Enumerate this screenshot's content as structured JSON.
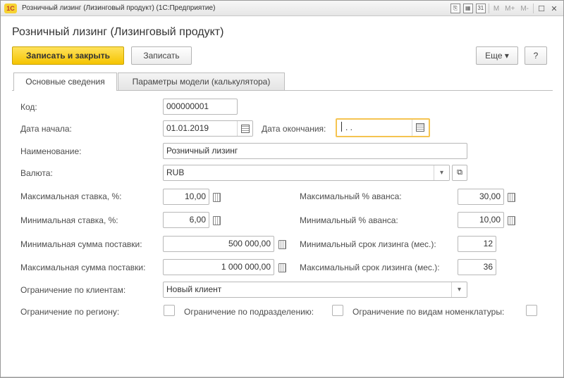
{
  "window": {
    "title": "Розничный лизинг (Лизинговый продукт)  (1С:Предприятие)",
    "logo_text": "1С",
    "memory_labels": [
      "M",
      "M+",
      "M-"
    ],
    "calendar_day": "31"
  },
  "form": {
    "title": "Розничный лизинг (Лизинговый продукт)"
  },
  "toolbar": {
    "save_close_label": "Записать и закрыть",
    "save_label": "Записать",
    "more_label": "Еще ▾",
    "help_label": "?"
  },
  "tabs": [
    {
      "label": "Основные сведения",
      "active": true
    },
    {
      "label": "Параметры модели (калькулятора)",
      "active": false
    }
  ],
  "fields": {
    "code": {
      "label": "Код:",
      "value": "000000001"
    },
    "start_date": {
      "label": "Дата начала:",
      "value": "01.01.2019"
    },
    "end_date": {
      "label": "Дата окончания:",
      "value": " .  ."
    },
    "name": {
      "label": "Наименование:",
      "value": "Розничный лизинг"
    },
    "currency": {
      "label": "Валюта:",
      "value": "RUB"
    },
    "max_rate": {
      "label": "Максимальная ставка, %:",
      "value": "10,00"
    },
    "min_rate": {
      "label": "Минимальная ставка, %:",
      "value": "6,00"
    },
    "min_supply": {
      "label": "Минимальная сумма поставки:",
      "value": "500 000,00"
    },
    "max_supply": {
      "label": "Максимальная сумма поставки:",
      "value": "1 000 000,00"
    },
    "max_advance": {
      "label": "Максимальный % аванса:",
      "value": "30,00"
    },
    "min_advance": {
      "label": "Минимальный % аванса:",
      "value": "10,00"
    },
    "min_term": {
      "label": "Минимальный срок лизинга (мес.):",
      "value": "12"
    },
    "max_term": {
      "label": "Максимальный срок лизинга (мес.):",
      "value": "36"
    },
    "client_restriction": {
      "label": "Ограничение по клиентам:",
      "value": "Новый клиент"
    },
    "region_restriction": {
      "label": "Ограничение по региону:",
      "checked": false
    },
    "division_restriction": {
      "label": "Ограничение по подразделению:",
      "checked": false
    },
    "nomenclature_restriction": {
      "label": "Ограничение по видам номенклатуры:",
      "checked": false
    }
  },
  "colors": {
    "primary_button": "#f5c400",
    "focus_border": "#f5c451"
  }
}
